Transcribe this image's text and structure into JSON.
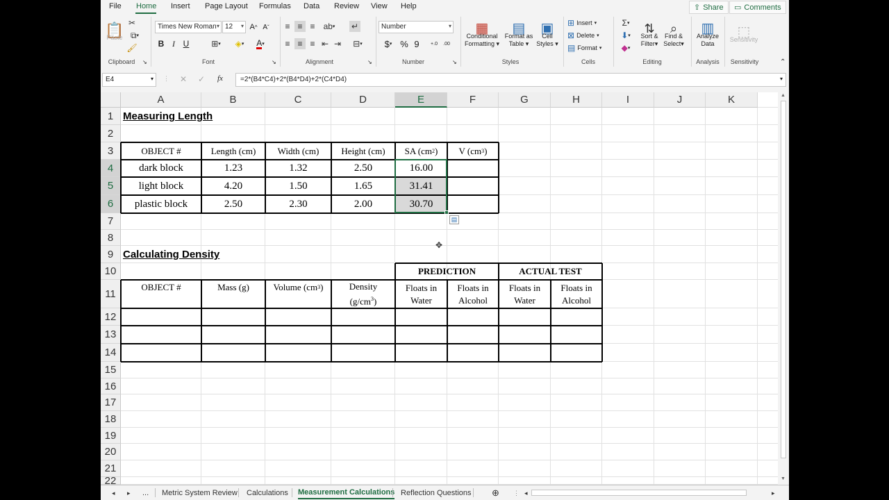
{
  "menu": {
    "items": [
      "File",
      "Home",
      "Insert",
      "Page Layout",
      "Formulas",
      "Data",
      "Review",
      "View",
      "Help"
    ],
    "active": "Home",
    "share": "Share",
    "comments": "Comments"
  },
  "ribbon": {
    "groups": {
      "clipboard": "Clipboard",
      "font": "Font",
      "alignment": "Alignment",
      "number": "Number",
      "styles": "Styles",
      "cells": "Cells",
      "editing": "Editing",
      "analysis": "Analysis",
      "sensitivity": "Sensitivity"
    },
    "paste": "Paste",
    "font_name": "Times New Roman",
    "font_size": "12",
    "number_format": "Number",
    "conditional_formatting": [
      "Conditional",
      "Formatting"
    ],
    "format_as_table": [
      "Format as",
      "Table"
    ],
    "cell_styles": [
      "Cell",
      "Styles"
    ],
    "insert": "Insert",
    "delete": "Delete",
    "format": "Format",
    "sort_filter": [
      "Sort &",
      "Filter"
    ],
    "find_select": [
      "Find &",
      "Select"
    ],
    "analyze_data": [
      "Analyze",
      "Data"
    ],
    "sensitivity_btn": "Sensitivity",
    "bold": "B",
    "italic": "I",
    "underline": "U"
  },
  "formula_bar": {
    "name_box": "E4",
    "formula": "=2*(B4*C4)+2*(B4*D4)+2*(C4*D4)"
  },
  "columns": [
    "A",
    "B",
    "C",
    "D",
    "E",
    "F",
    "G",
    "H",
    "I",
    "J",
    "K"
  ],
  "rows": [
    "1",
    "2",
    "3",
    "4",
    "5",
    "6",
    "7",
    "8",
    "9",
    "10",
    "11",
    "12",
    "13",
    "14",
    "15",
    "16",
    "17",
    "18",
    "19",
    "20",
    "21",
    "22"
  ],
  "sheet": {
    "title1": "Measuring Length",
    "headers1": {
      "object": "OBJECT #",
      "length": "Length (cm)",
      "width": "Width (cm)",
      "height": "Height (cm)",
      "sa": "SA (cm",
      "sa_sup": "2",
      "v": "V (cm",
      "v_sup": "3"
    },
    "rows1": [
      {
        "object": "dark block",
        "length": "1.23",
        "width": "1.32",
        "height": "2.50",
        "sa": "16.00",
        "v": ""
      },
      {
        "object": "light block",
        "length": "4.20",
        "width": "1.50",
        "height": "1.65",
        "sa": "31.41",
        "v": ""
      },
      {
        "object": "plastic block",
        "length": "2.50",
        "width": "2.30",
        "height": "2.00",
        "sa": "30.70",
        "v": ""
      }
    ],
    "title2": "Calculating Density",
    "prediction": "PREDICTION",
    "actual_test": "ACTUAL TEST",
    "headers2": {
      "object": "OBJECT #",
      "mass": "Mass (g)",
      "volume": "Volume (cm",
      "volume_sup": "3",
      "density_a": "Density",
      "density_b": "(g/cm",
      "density_sup": "3",
      "floats_water_a": "Floats in",
      "floats_water_b": "Water",
      "floats_alcohol_a": "Floats in",
      "floats_alcohol_b": "Alcohol"
    }
  },
  "tabs": {
    "ellipsis": "...",
    "items": [
      "Metric System Review",
      "Calculations",
      "Measurement Calculations",
      "Reflection Questions"
    ],
    "active": "Measurement Calculations"
  }
}
